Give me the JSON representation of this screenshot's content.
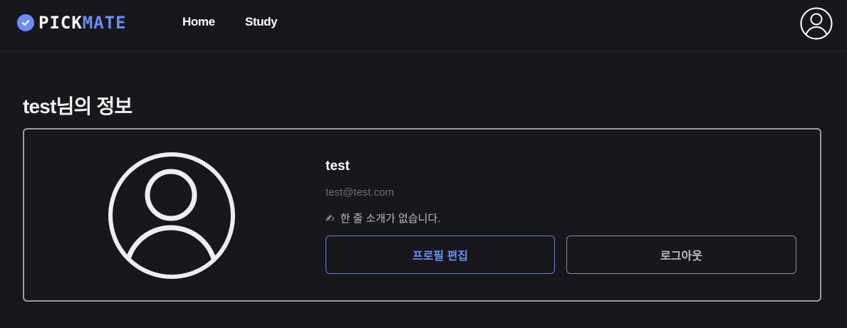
{
  "header": {
    "logo": {
      "part1": "PICK",
      "part2": "MATE"
    },
    "nav": [
      {
        "label": "Home"
      },
      {
        "label": "Study"
      }
    ]
  },
  "main": {
    "title": "test님의 정보",
    "profile": {
      "name": "test",
      "email": "test@test.com",
      "bio_icon": "✍",
      "bio": "한 줄 소개가 없습니다.",
      "edit_button": "프로필 편집",
      "logout_button": "로그아웃"
    }
  },
  "colors": {
    "accent": "#6a8ef5",
    "background": "#18181c"
  },
  "icons": [
    "check-icon",
    "user-avatar-icon"
  ]
}
